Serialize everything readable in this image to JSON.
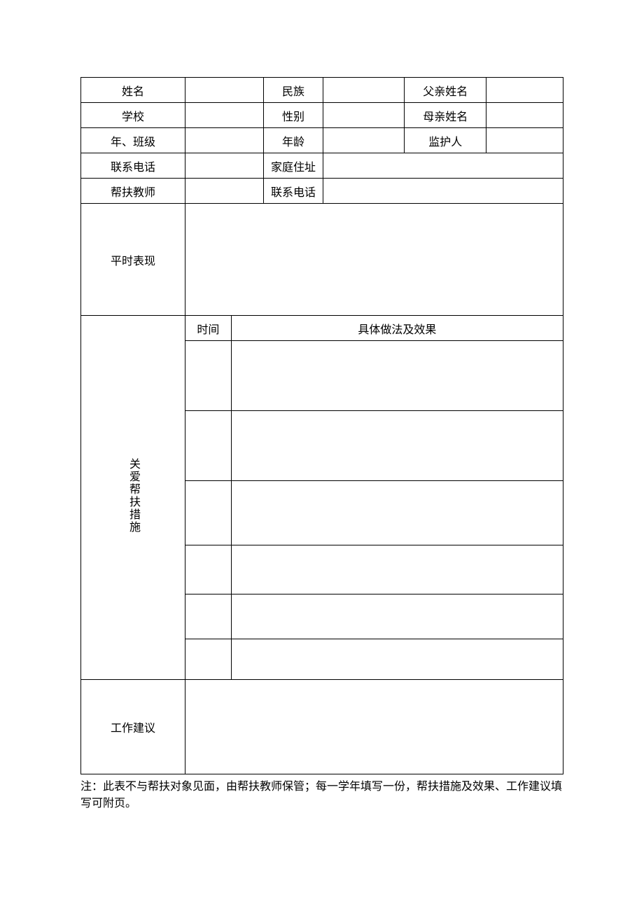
{
  "labels": {
    "name": "姓名",
    "ethnicity": "民族",
    "father_name": "父亲姓名",
    "school": "学校",
    "gender": "性别",
    "mother_name": "母亲姓名",
    "grade_class": "年、班级",
    "age": "年龄",
    "guardian": "监护人",
    "contact_phone": "联系电话",
    "home_address": "家庭住址",
    "support_teacher": "帮扶教师",
    "contact_phone2": "联系电话",
    "usual_performance": "平时表现",
    "care_support_measures": "关爱帮扶措施",
    "time": "时间",
    "practice_effect": "具体做法及效果",
    "work_suggestion": "工作建议"
  },
  "values": {
    "name": "",
    "ethnicity": "",
    "father_name": "",
    "school": "",
    "gender": "",
    "mother_name": "",
    "grade_class": "",
    "age": "",
    "guardian": "",
    "contact_phone": "",
    "home_address": "",
    "support_teacher": "",
    "contact_phone2": "",
    "usual_performance": "",
    "work_suggestion": ""
  },
  "note": "注：此表不与帮扶对象见面，由帮扶教师保管；每一学年填写一份，帮扶措施及效果、工作建议填写可附页。"
}
